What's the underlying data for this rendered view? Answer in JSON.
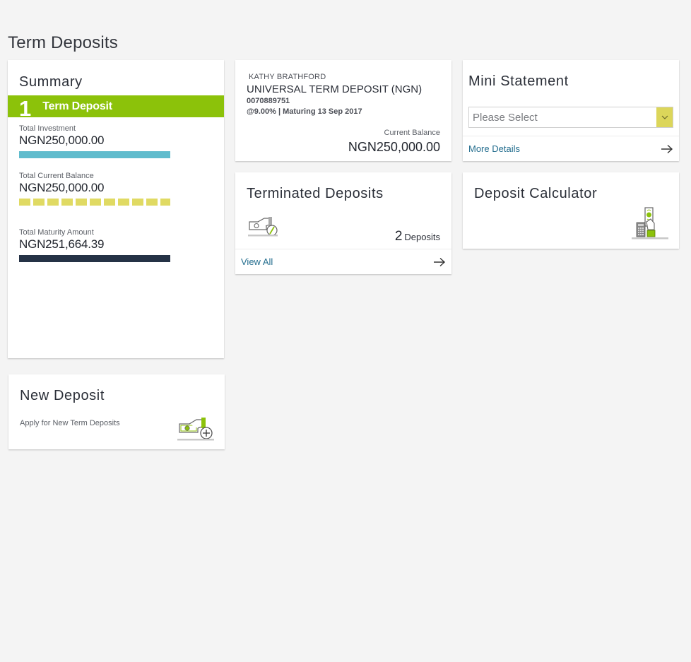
{
  "page": {
    "title": "Term Deposits"
  },
  "summary": {
    "title": "Summary",
    "deposit_count": "1",
    "deposit_count_label": "Term Deposit",
    "metrics": [
      {
        "label": "Total Investment",
        "value": "NGN250,000.00",
        "bar_style": "solid",
        "bar_color": "#60bccd",
        "fill_percent": 100
      },
      {
        "label": "Total Current Balance",
        "value": "NGN250,000.00",
        "bar_style": "dashed",
        "bar_color": "#e0da63",
        "fill_percent": 100
      },
      {
        "label": "Total Maturity Amount",
        "value": "NGN251,664.39",
        "bar_style": "solid",
        "bar_color": "#253246",
        "fill_percent": 100
      }
    ],
    "band_color": "#8cc20a"
  },
  "account": {
    "holder": "KATHY BRATHFORD",
    "product": "UNIVERSAL TERM DEPOSIT (NGN)",
    "number": "0070889751",
    "rate_maturity": "@9.00% | Maturing 13 Sep 2017",
    "balance_label": "Current Balance",
    "balance_value": "NGN250,000.00"
  },
  "mini_statement": {
    "title": "Mini Statement",
    "select_value": "Please Select",
    "link_label": "More Details"
  },
  "terminated": {
    "title": "Terminated Deposits",
    "count": "2",
    "count_unit": "Deposits",
    "link_label": "View All",
    "icon": "terminated-deposit-icon"
  },
  "calculator": {
    "title": "Deposit Calculator",
    "icon": "deposit-calculator-icon"
  },
  "new_deposit": {
    "title": "New Deposit",
    "subtitle": "Apply for New Term Deposits",
    "icon": "new-deposit-icon"
  },
  "colors": {
    "link": "#236d8e",
    "select_button": "#dcd65a",
    "icon_green": "#8cc20a"
  }
}
